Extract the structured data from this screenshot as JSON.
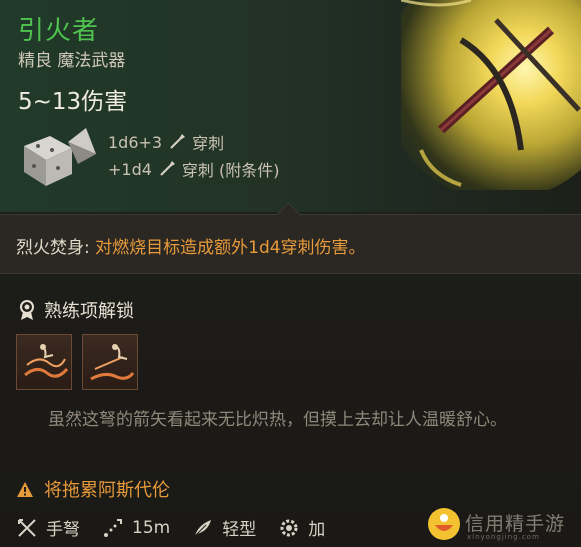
{
  "item": {
    "name": "引火者",
    "rarity_type": "精良 魔法武器",
    "damage": "5~13伤害",
    "damage_lines": [
      {
        "dice": "1d6+3",
        "type": "穿刺"
      },
      {
        "dice": "+1d4",
        "type": "穿刺 (附条件)"
      }
    ]
  },
  "ability": {
    "name": "烈火焚身:",
    "description": " 对燃烧目标造成额外1d4穿刺伤害。"
  },
  "proficiency": {
    "heading": "熟练项解锁"
  },
  "flavor_text": "虽然这弩的箭矢看起来无比炽热，但摸上去却让人温暖舒心。",
  "warning": "将拖累阿斯代伦",
  "stats": [
    {
      "icon": "crossbow-icon",
      "label": "手弩"
    },
    {
      "icon": "range-icon",
      "label": "15m"
    },
    {
      "icon": "feather-icon",
      "label": "轻型"
    },
    {
      "icon": "gear-icon",
      "label": "加"
    }
  ],
  "watermark": {
    "text": "信用精手游",
    "sub": "xinyongjing.com"
  },
  "colors": {
    "title_green": "#4fc24f",
    "orange": "#e79a3a",
    "text": "#d8d2c4",
    "muted": "#8f887a"
  }
}
